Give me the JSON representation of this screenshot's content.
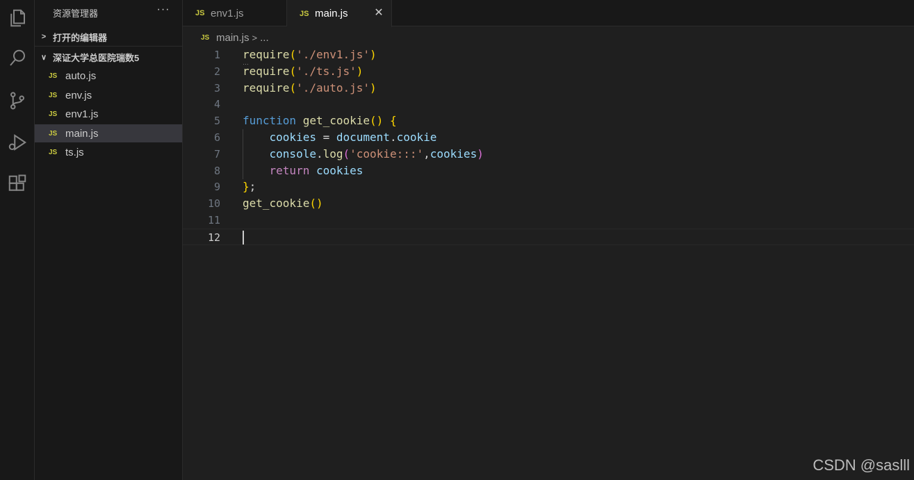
{
  "explorer": {
    "title": "资源管理器",
    "more": "···",
    "open_editors_label": "打开的编辑器",
    "folder_label": "深证大学总医院瑞数5",
    "files": [
      {
        "badge": "JS",
        "name": "auto.js"
      },
      {
        "badge": "JS",
        "name": "env.js"
      },
      {
        "badge": "JS",
        "name": "env1.js"
      },
      {
        "badge": "JS",
        "name": "main.js"
      },
      {
        "badge": "JS",
        "name": "ts.js"
      }
    ]
  },
  "activity_bar": {
    "icons": [
      "files-icon",
      "search-icon",
      "source-control-icon",
      "run-debug-icon",
      "extensions-icon"
    ]
  },
  "tabs": [
    {
      "badge": "JS",
      "label": "env1.js",
      "active": false
    },
    {
      "badge": "JS",
      "label": "main.js",
      "active": true,
      "close": "✕"
    }
  ],
  "breadcrumb": {
    "badge": "JS",
    "file": "main.js",
    "sep": ">",
    "more": "..."
  },
  "editor": {
    "current_line": 12,
    "lines": [
      {
        "n": "1",
        "tokens": [
          {
            "t": "require",
            "c": "t-fn"
          },
          {
            "t": "(",
            "c": "t-br1"
          },
          {
            "t": "'./env1.js'",
            "c": "t-str"
          },
          {
            "t": ")",
            "c": "t-br1"
          }
        ]
      },
      {
        "n": "2",
        "tokens": [
          {
            "t": "require",
            "c": "t-fn"
          },
          {
            "t": "(",
            "c": "t-br1"
          },
          {
            "t": "'./ts.js'",
            "c": "t-str"
          },
          {
            "t": ")",
            "c": "t-br1"
          }
        ]
      },
      {
        "n": "3",
        "tokens": [
          {
            "t": "require",
            "c": "t-fn"
          },
          {
            "t": "(",
            "c": "t-br1"
          },
          {
            "t": "'./auto.js'",
            "c": "t-str"
          },
          {
            "t": ")",
            "c": "t-br1"
          }
        ]
      },
      {
        "n": "4",
        "tokens": []
      },
      {
        "n": "5",
        "tokens": [
          {
            "t": "function",
            "c": "t-kw"
          },
          {
            "t": " ",
            "c": "t-plain"
          },
          {
            "t": "get_cookie",
            "c": "t-fn"
          },
          {
            "t": "()",
            "c": "t-br1"
          },
          {
            "t": " ",
            "c": "t-plain"
          },
          {
            "t": "{",
            "c": "t-br1"
          }
        ]
      },
      {
        "n": "6",
        "tokens": [
          {
            "t": "    ",
            "c": "t-plain"
          },
          {
            "t": "cookies",
            "c": "t-var"
          },
          {
            "t": " = ",
            "c": "t-plain"
          },
          {
            "t": "document",
            "c": "t-var"
          },
          {
            "t": ".",
            "c": "t-plain"
          },
          {
            "t": "cookie",
            "c": "t-var"
          }
        ]
      },
      {
        "n": "7",
        "tokens": [
          {
            "t": "    ",
            "c": "t-plain"
          },
          {
            "t": "console",
            "c": "t-var"
          },
          {
            "t": ".",
            "c": "t-plain"
          },
          {
            "t": "log",
            "c": "t-fn"
          },
          {
            "t": "(",
            "c": "t-br2"
          },
          {
            "t": "'cookie:::'",
            "c": "t-str"
          },
          {
            "t": ",",
            "c": "t-plain"
          },
          {
            "t": "cookies",
            "c": "t-var"
          },
          {
            "t": ")",
            "c": "t-br2"
          }
        ]
      },
      {
        "n": "8",
        "tokens": [
          {
            "t": "    ",
            "c": "t-plain"
          },
          {
            "t": "return",
            "c": "t-kw2"
          },
          {
            "t": " ",
            "c": "t-plain"
          },
          {
            "t": "cookies",
            "c": "t-var"
          }
        ]
      },
      {
        "n": "9",
        "tokens": [
          {
            "t": "}",
            "c": "t-br1"
          },
          {
            "t": ";",
            "c": "t-plain"
          }
        ]
      },
      {
        "n": "10",
        "tokens": [
          {
            "t": "get_cookie",
            "c": "t-fn"
          },
          {
            "t": "()",
            "c": "t-br1"
          }
        ]
      },
      {
        "n": "11",
        "tokens": []
      },
      {
        "n": "12",
        "tokens": []
      }
    ]
  },
  "watermark": "CSDN @saslll"
}
